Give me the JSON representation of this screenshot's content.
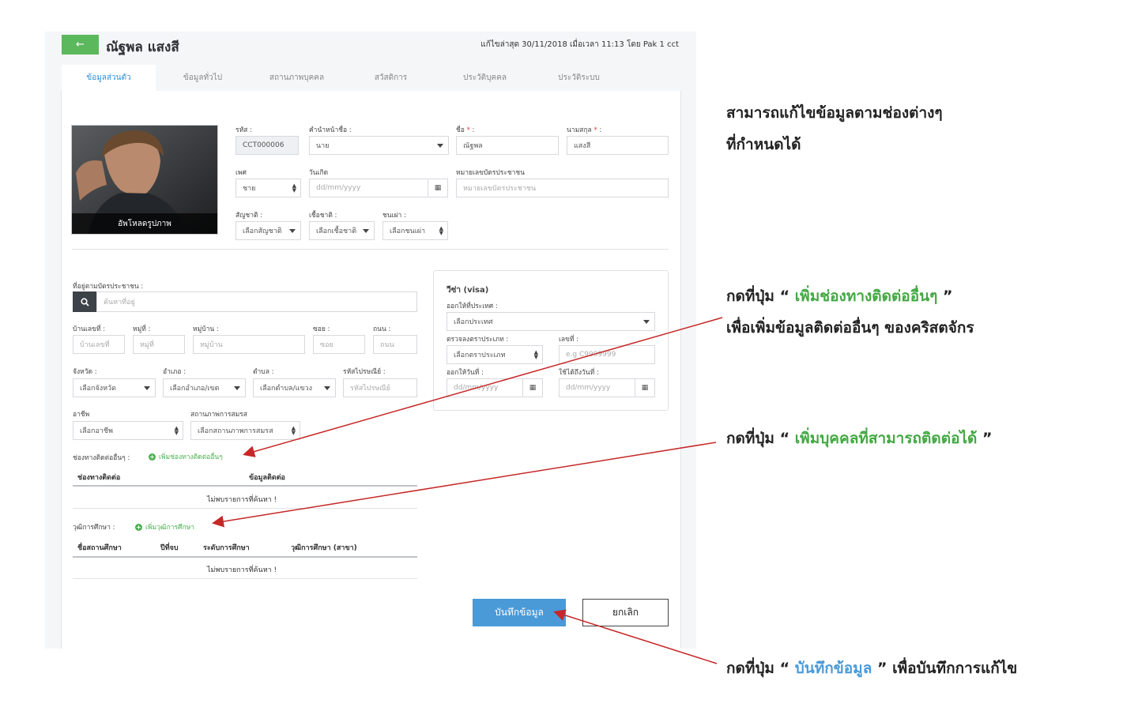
{
  "header": {
    "back_label": "←",
    "title": "ณัฐพล แสงสี",
    "modified": "แก้ไขล่าสุด 30/11/2018 เมื่อเวลา 11:13 โดย Pak 1 cct"
  },
  "tabs": [
    {
      "label": "ข้อมูลส่วนตัว",
      "active": true
    },
    {
      "label": "ข้อมูลทั่วไป"
    },
    {
      "label": "สถานภาพบุคคล"
    },
    {
      "label": "สวัสดิการ"
    },
    {
      "label": "ประวัติบุคคล"
    },
    {
      "label": "ประวัติระบบ"
    }
  ],
  "photo": {
    "caption": "อัพโหลดรูปภาพ"
  },
  "personal": {
    "code_label": "รหัส :",
    "code_value": "CCT000006",
    "prefix_label": "คำนำหน้าชื่อ :",
    "prefix_value": "นาย",
    "firstname_label": "ชื่อ",
    "firstname_value": "ณัฐพล",
    "lastname_label": "นามสกุล",
    "lastname_value": "แสงสี",
    "required_mark": "*",
    "colon": ":",
    "gender_label": "เพศ",
    "gender_value": "ชาย",
    "birthdate_label": "วันเกิด",
    "birthdate_placeholder": "dd/mm/yyyy",
    "idcard_label": "หมายเลขบัตรประชาชน",
    "idcard_placeholder": "หมายเลขบัตรประชาชน",
    "nationality_label": "สัญชาติ :",
    "nationality_value": "เลือกสัญชาติ",
    "race_label": "เชื้อชาติ :",
    "race_value": "เลือกเชื้อชาติ",
    "tribe_label": "ชนเผ่า :",
    "tribe_value": "เลือกชนเผ่า"
  },
  "address": {
    "label": "ที่อยู่ตามบัตรประชาชน :",
    "search_placeholder": "ค้นหาที่อยู่",
    "house_no_label": "บ้านเลขที่ :",
    "house_no_placeholder": "บ้านเลขที่",
    "moo_label": "หมู่ที่ :",
    "moo_placeholder": "หมู่ที่",
    "village_label": "หมู่บ้าน :",
    "village_placeholder": "หมู่บ้าน",
    "soi_label": "ซอย :",
    "soi_placeholder": "ซอย",
    "road_label": "ถนน :",
    "road_placeholder": "ถนน",
    "province_label": "จังหวัด :",
    "province_value": "เลือกจังหวัด",
    "district_label": "อำเภอ :",
    "district_value": "เลือกอำเภอ/เขต",
    "subdistrict_label": "ตำบล :",
    "subdistrict_value": "เลือกตำบล/แขวง",
    "postcode_label": "รหัสไปรษณีย์ :",
    "postcode_placeholder": "รหัสไปรษณีย์"
  },
  "career": {
    "occupation_label": "อาชีพ",
    "occupation_value": "เลือกอาชีพ",
    "marital_label": "สถานภาพการสมรส",
    "marital_value": "เลือกสถานภาพการสมรส"
  },
  "visa": {
    "title": "วีซ่า (visa)",
    "country_label": "ออกให้ที่ประเทศ :",
    "country_value": "เลือกประเทศ",
    "type_label": "ตรวจลงตราประเภท :",
    "type_value": "เลือกตราประเภท",
    "number_label": "เลขที่ :",
    "number_placeholder": "e.g C9999999",
    "issue_label": "ออกให้วันที่ :",
    "issue_placeholder": "dd/mm/yyyy",
    "expire_label": "ใช้ได้ถึงวันที่ :",
    "expire_placeholder": "dd/mm/yyyy"
  },
  "contacts": {
    "label": "ช่องทางติดต่ออื่นๆ :",
    "add_label": "เพิ่มช่องทางติดต่ออื่นๆ",
    "columns": [
      "ช่องทางติดต่อ",
      "ข้อมูลติดต่อ"
    ],
    "empty": "ไม่พบรายการที่ค้นหา !"
  },
  "education": {
    "label": "วุฒิการศึกษา :",
    "add_label": "เพิ่มวุฒิการศึกษา",
    "columns": [
      "ชื่อสถานศึกษา",
      "ปีที่จบ",
      "ระดับการศึกษา",
      "วุฒิการศึกษา (สาขา)"
    ],
    "empty": "ไม่พบรายการที่ค้นหา !"
  },
  "actions": {
    "save_label": "บันทึกข้อมูล",
    "cancel_label": "ยกเลิก"
  },
  "annotations": {
    "edit_line1": "สามารถแก้ไขข้อมูลตามช่องต่างๆ",
    "edit_line2": "ที่กำหนดได้",
    "contact_prefix": "กดที่ปุ่ม “",
    "contact_highlight": "เพิ่มช่องทางติดต่ออื่นๆ",
    "contact_suffix": "”",
    "contact_line2": "เพื่อเพิ่มข้อมูลติดต่ออื่นๆ ของคริสตจักร",
    "person_prefix": "กดที่ปุ่ม “",
    "person_highlight": "เพิ่มบุคคลที่สามารถติดต่อได้",
    "person_suffix": "”",
    "save_prefix": "กดที่ปุ่ม “",
    "save_highlight": "บันทึกข้อมูล",
    "save_suffix": "” เพื่อบันทึกการแก้ไข"
  },
  "colors": {
    "accent": "#4a9ad8",
    "success": "#43a843",
    "arrow": "#c62828"
  }
}
